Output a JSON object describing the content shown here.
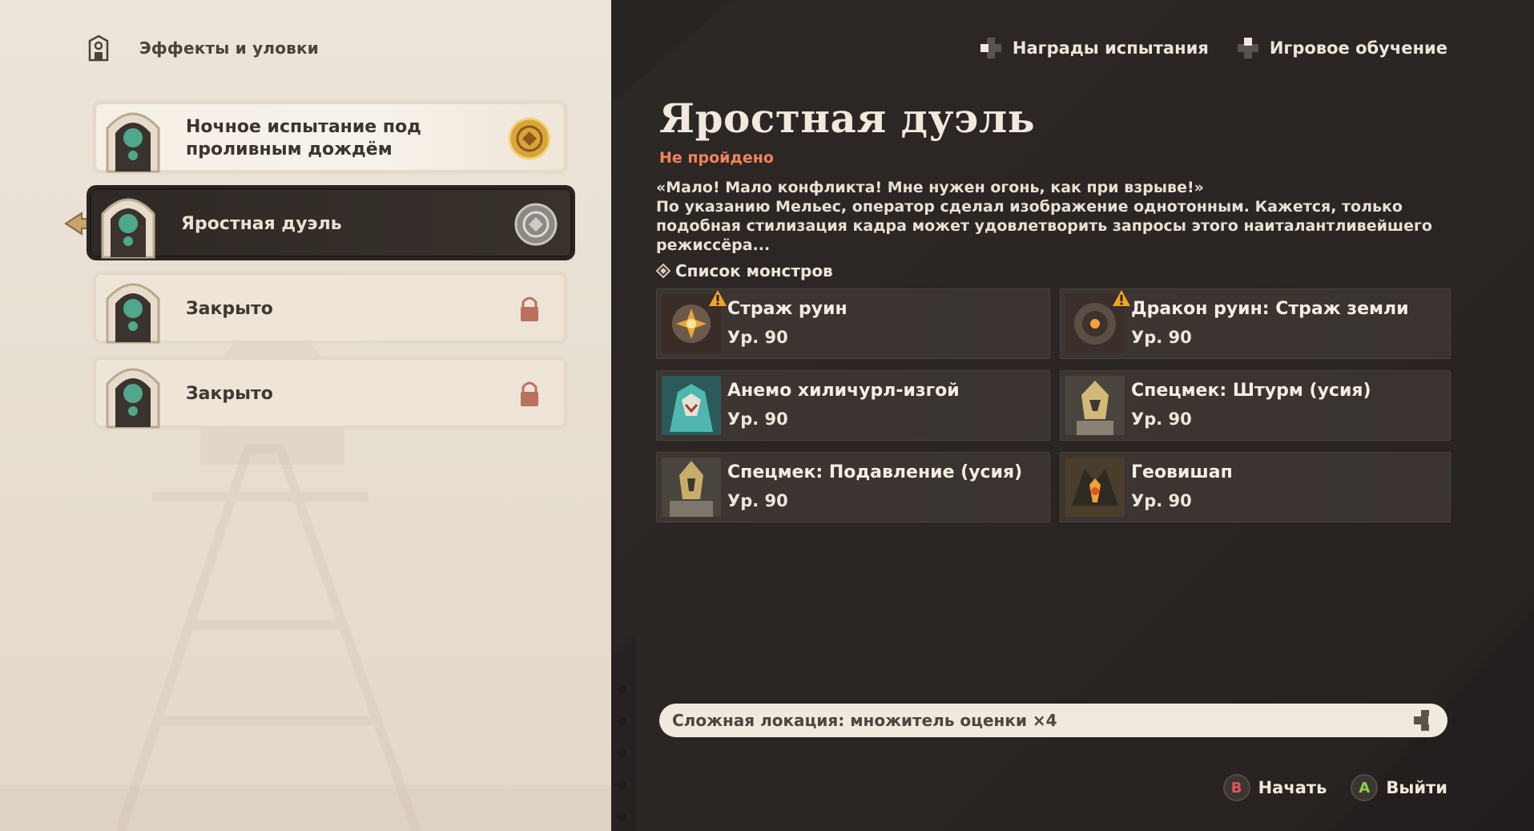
{
  "header": {
    "left_title": "Эффекты и уловки",
    "links": [
      {
        "label": "Награды испытания",
        "icon": "dpad-left-icon"
      },
      {
        "label": "Игровое обучение",
        "icon": "dpad-up-icon"
      }
    ]
  },
  "levels": [
    {
      "label_line1": "Ночное испытание под",
      "label_line2": "проливным дождём",
      "state": "completed",
      "badge": "gold-medal-icon"
    },
    {
      "label_line1": "Яростная дуэль",
      "state": "selected",
      "badge": "silver-medal-icon"
    },
    {
      "label_line1": "Закрыто",
      "state": "locked",
      "badge": "lock-icon"
    },
    {
      "label_line1": "Закрыто",
      "state": "locked",
      "badge": "lock-icon"
    }
  ],
  "trial": {
    "title": "Яростная дуэль",
    "status": "Не пройдено",
    "desc_line1": "«Мало! Мало конфликта! Мне нужен огонь, как при взрыве!»",
    "desc_line2": "По указанию Мельес, оператор сделал изображение однотонным. Кажется, только",
    "desc_line3": "подобная стилизация кадра может удовлетворить запросы этого наиталантливейшего",
    "desc_line4": "режиссёра..."
  },
  "monsters": {
    "header": "Список монстров",
    "items": [
      {
        "name": "Страж руин",
        "level": "Ур. 90",
        "warning": true
      },
      {
        "name": "Дракон руин: Страж земли",
        "level": "Ур. 90",
        "warning": true
      },
      {
        "name": "Анемо хиличурл-изгой",
        "level": "Ур. 90",
        "warning": false
      },
      {
        "name": "Спецмек: Штурм (усия)",
        "level": "Ур. 90",
        "warning": false
      },
      {
        "name": "Спецмек: Подавление (усия)",
        "level": "Ур. 90",
        "warning": false
      },
      {
        "name": "Геовишап",
        "level": "Ур. 90",
        "warning": false
      }
    ]
  },
  "difficulty": {
    "text": "Сложная локация: множитель оценки ×4"
  },
  "buttons": {
    "start": {
      "key": "B",
      "label": "Начать",
      "color": "#e05563"
    },
    "exit": {
      "key": "A",
      "label": "Выйти",
      "color": "#8fd14f"
    }
  },
  "colors": {
    "status_failed": "#f08457",
    "accent_green": "#4fa88a",
    "gold": "#d9a43a"
  }
}
